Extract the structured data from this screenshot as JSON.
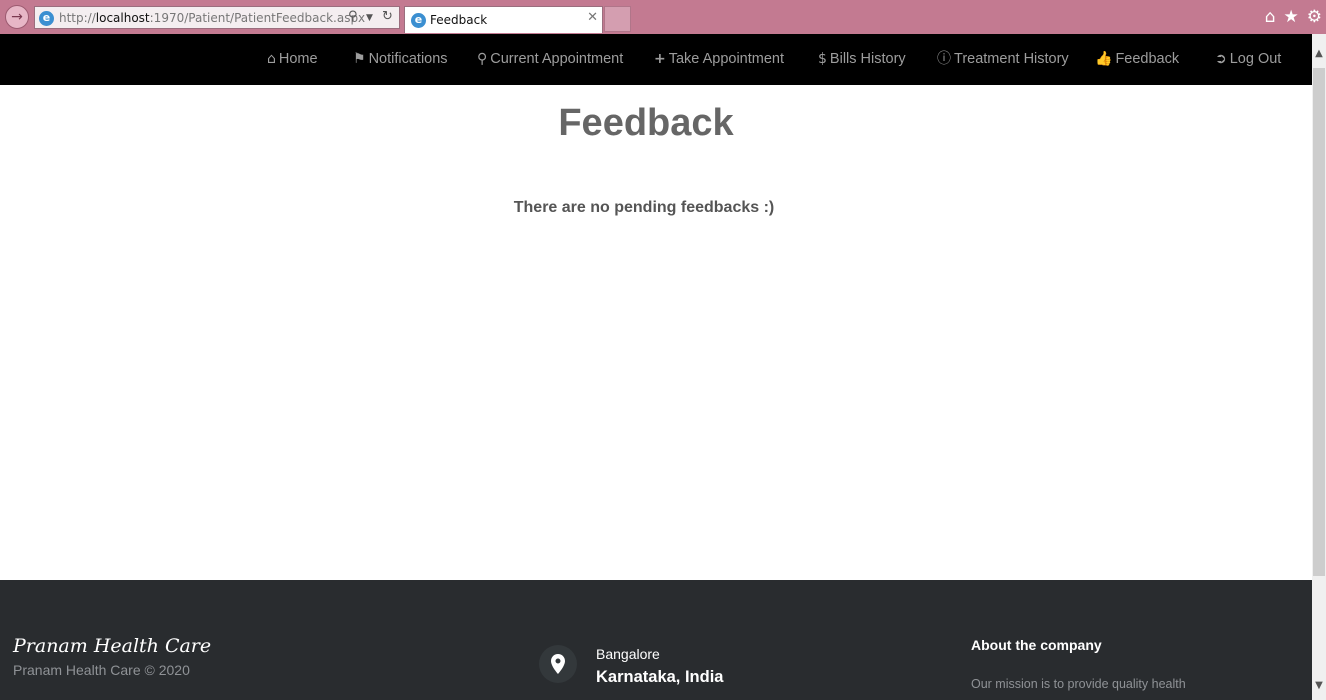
{
  "browser": {
    "url_prefix": "http://",
    "url_host": "localhost",
    "url_rest": ":1970/Patient/PatientFeedback.aspx",
    "tab_title": "Feedback",
    "chrome_color": "#c37a91"
  },
  "nav": {
    "items": [
      {
        "label": "Home",
        "icon": "home-icon"
      },
      {
        "label": "Notifications",
        "icon": "flag-icon"
      },
      {
        "label": "Current Appointment",
        "icon": "search-icon"
      },
      {
        "label": "Take Appointment",
        "icon": "plus-icon"
      },
      {
        "label": "Bills History",
        "icon": "dollar-icon"
      },
      {
        "label": "Treatment History",
        "icon": "info-icon"
      },
      {
        "label": "Feedback",
        "icon": "thumbs-up-icon"
      },
      {
        "label": "Log Out",
        "icon": "log-in-icon"
      }
    ]
  },
  "main": {
    "title": "Feedback",
    "message": "There are no pending feedbacks :)"
  },
  "footer": {
    "brand": "Pranam Health Care",
    "copyright": "Pranam Health Care © 2020",
    "location_city": "Bangalore",
    "location_region": "Karnataka, India",
    "about_title": "About the company",
    "about_text": "Our mission is to provide quality health"
  }
}
